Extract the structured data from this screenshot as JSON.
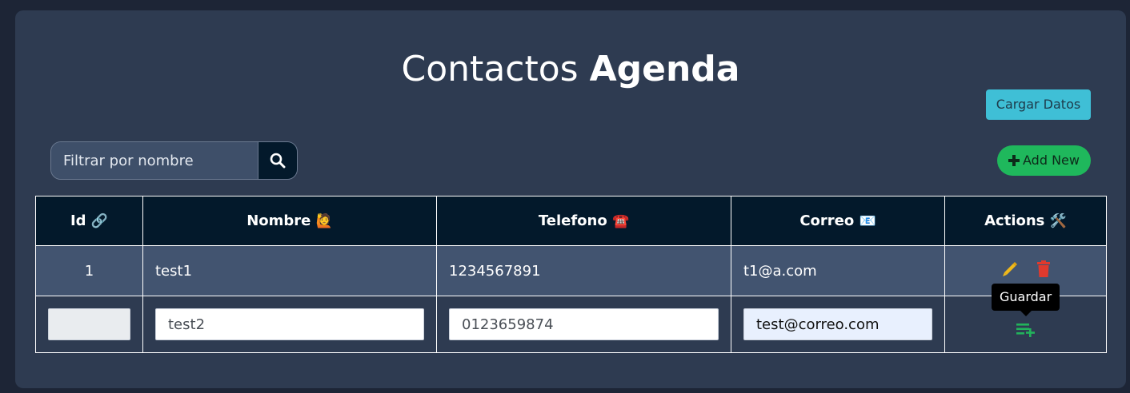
{
  "header": {
    "title_light": "Contactos",
    "title_bold": "Agenda"
  },
  "toolbar": {
    "load_label": "Cargar Datos",
    "add_label": "Add New"
  },
  "search": {
    "placeholder": "Filtrar por nombre"
  },
  "table": {
    "headers": [
      {
        "label": "Id",
        "emoji": "🔗"
      },
      {
        "label": "Nombre",
        "emoji": "🙋"
      },
      {
        "label": "Telefono",
        "emoji": "☎️"
      },
      {
        "label": "Correo",
        "emoji": "📧"
      },
      {
        "label": "Actions",
        "emoji": "🛠️"
      }
    ],
    "rows": [
      {
        "id": "1",
        "name": "test1",
        "phone": "1234567891",
        "email": "t1@a.com"
      }
    ],
    "new_row": {
      "id": "",
      "name": "test2",
      "phone": "0123659874",
      "email": "test@correo.com"
    }
  },
  "tooltip": {
    "text": "Guardar"
  },
  "colors": {
    "accent_cyan": "#3fbfd6",
    "accent_green": "#1fb85c",
    "edit": "#f0b91a",
    "delete": "#e03a2d",
    "save": "#22b35b"
  },
  "icons": {
    "search": "search-icon",
    "edit": "pencil-icon",
    "delete": "trash-icon",
    "save": "playlist-add-icon",
    "add": "plus-icon"
  }
}
